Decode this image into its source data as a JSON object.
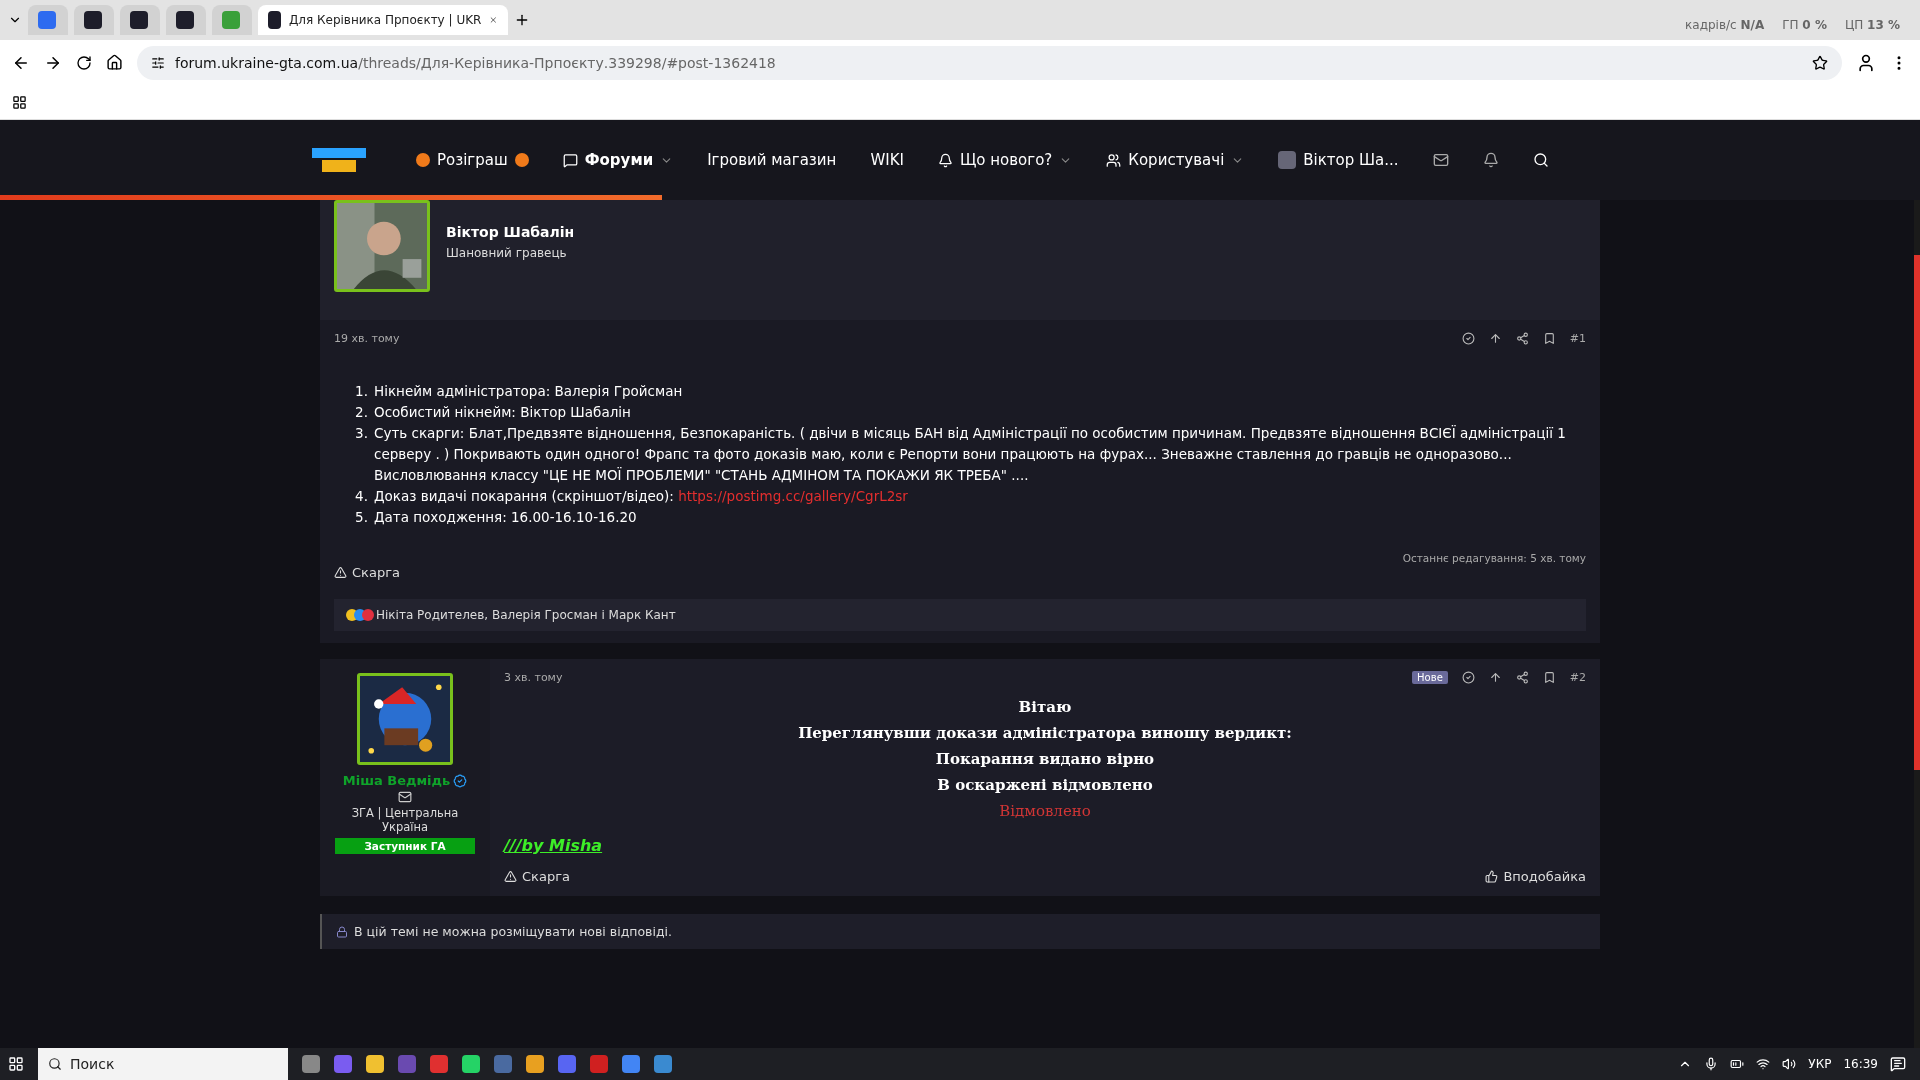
{
  "browser": {
    "tabs": [
      {
        "kind": "pinned",
        "selected": false
      },
      {
        "kind": "pinned",
        "selected": false
      },
      {
        "kind": "pinned",
        "selected": false
      },
      {
        "kind": "pinned",
        "selected": false
      },
      {
        "kind": "pinned",
        "selected": false
      },
      {
        "kind": "page",
        "title": "Для Керівника Прпоєкту | UKR",
        "selected": true
      }
    ],
    "url_host": "forum.ukraine-gta.com.ua",
    "url_path": "/threads/Для-Керівника-Прпоєкту.339298/#post-1362418",
    "overlay": [
      {
        "label": "кадрів/с",
        "value": "N/A"
      },
      {
        "label": "ГП",
        "value": "0 %"
      },
      {
        "label": "ЦП",
        "value": "13 %"
      }
    ]
  },
  "nav": {
    "items": [
      {
        "label": "Розіграш",
        "dropdown": false,
        "selected": false
      },
      {
        "label": "Форуми",
        "dropdown": true,
        "selected": true
      },
      {
        "label": "Ігровий магазин",
        "dropdown": false,
        "selected": false
      },
      {
        "label": "WIKI",
        "dropdown": false,
        "selected": false
      },
      {
        "label": "Що нового?",
        "dropdown": true,
        "selected": false
      },
      {
        "label": "Користувачі",
        "dropdown": true,
        "selected": false
      }
    ],
    "user": "Віктор Ша...",
    "progress": {
      "level": 0.345
    }
  },
  "post1": {
    "author": "Віктор Шабалін",
    "title": "Шановний гравець",
    "time": "19 хв. тому",
    "number": "#1",
    "items": [
      {
        "number": "1.",
        "text": "Нікнейм адміністратора: Валерія Гройсман"
      },
      {
        "number": "2.",
        "text": "Особистий нікнейм: Віктор Шабалін"
      },
      {
        "number": "3.",
        "text": "Суть скарги: Блат,Предвзяте відношення, Безпокараність. ( двічи в місяць БАН від Адміністрації по особистим причинам. Предвзяте відношення ВСІЄЇ адміністрації 1 серверу . ) Покривають один одного! Фрапс та фото доказів маю, коли є Репорти вони працюють на фурах... Зневажне ставлення до гравців не одноразово... Висловлювання классу \"ЦЕ НЕ МОЇ ПРОБЛЕМИ\" \"СТАНЬ АДМІНОМ ТА ПОКАЖИ ЯК ТРЕБА\" ...."
      },
      {
        "number": "4.",
        "text": "Доказ видачі покарання (скріншот/відео): ",
        "link": "https://postimg.cc/gallery/CgrL2sr"
      },
      {
        "number": "5.",
        "text": "Дата походження: 16.00-16.10-16.20"
      }
    ],
    "edited": "Останнє редагування: 5 хв. тому",
    "report": "Скарга",
    "reactions": "Нікіта Родителев, Валерія Гросман і Марк Кант"
  },
  "post2": {
    "author": "Міша Ведмідь",
    "verified": true,
    "location": "ЗГА | Центральна Україна",
    "role": "Заступник ГА",
    "time": "3 хв. тому",
    "badge": "Нове",
    "number": "#2",
    "lines": [
      {
        "text": "Вітаю",
        "kind": "normal"
      },
      {
        "text": "Переглянувши докази адміністратора виношу вердикт:",
        "kind": "normal"
      },
      {
        "text": "Покарання видано вірно",
        "kind": "normal"
      },
      {
        "text": "В оскаржені відмовлено",
        "kind": "normal"
      },
      {
        "text": "Відмовлено",
        "kind": "denied"
      }
    ],
    "signature": "///by Misha",
    "report": "Скарга",
    "like": "Вподобайка"
  },
  "locked": "В цій темі не можна розміщувати нові відповіді.",
  "taskbar": {
    "search": "Поиск",
    "language": "УКР",
    "time": "16:39"
  }
}
